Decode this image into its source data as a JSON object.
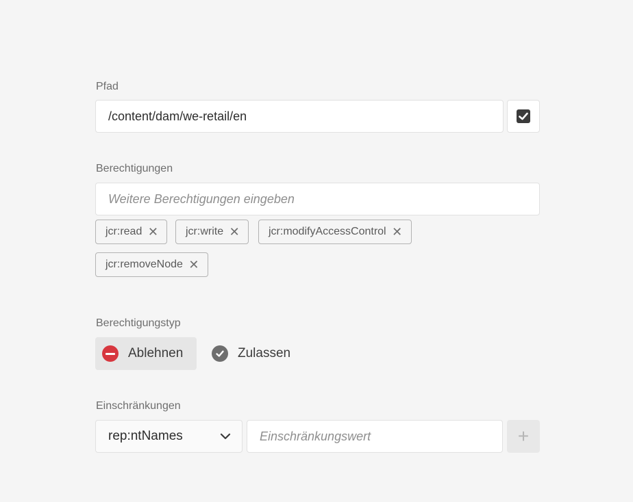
{
  "path": {
    "label": "Pfad",
    "value": "/content/dam/we-retail/en",
    "browse_icon": "checkbox-checked-icon"
  },
  "permissions": {
    "label": "Berechtigungen",
    "placeholder": "Weitere Berechtigungen eingeben",
    "tags": [
      {
        "label": "jcr:read"
      },
      {
        "label": "jcr:write"
      },
      {
        "label": "jcr:modifyAccessControl"
      },
      {
        "label": "jcr:removeNode"
      }
    ],
    "remove_glyph": "✕"
  },
  "permission_type": {
    "label": "Berechtigungstyp",
    "options": [
      {
        "label": "Ablehnen",
        "icon": "deny-icon",
        "selected": true,
        "color": "#d7373f"
      },
      {
        "label": "Zulassen",
        "icon": "allow-icon",
        "selected": false,
        "color": "#6e6e6e"
      }
    ]
  },
  "restrictions": {
    "label": "Einschränkungen",
    "select_value": "rep:ntNames",
    "value_placeholder": "Einschränkungswert",
    "add_glyph": "+"
  }
}
